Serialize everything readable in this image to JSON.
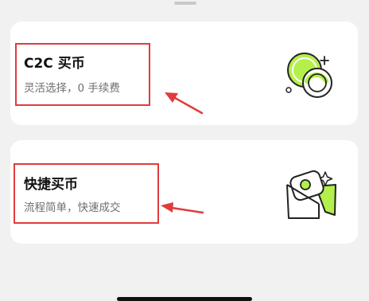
{
  "options": [
    {
      "title": "C2C 买币",
      "subtitle": "灵活选择，0 手续费",
      "icon": "coins-icon"
    },
    {
      "title": "快捷买币",
      "subtitle": "流程简单，快速成交",
      "icon": "quick-buy-icon"
    }
  ],
  "colors": {
    "accent": "#b4f04b",
    "highlight": "#e03c3c",
    "card_bg": "#ffffff",
    "page_bg": "#f1f1f1"
  }
}
